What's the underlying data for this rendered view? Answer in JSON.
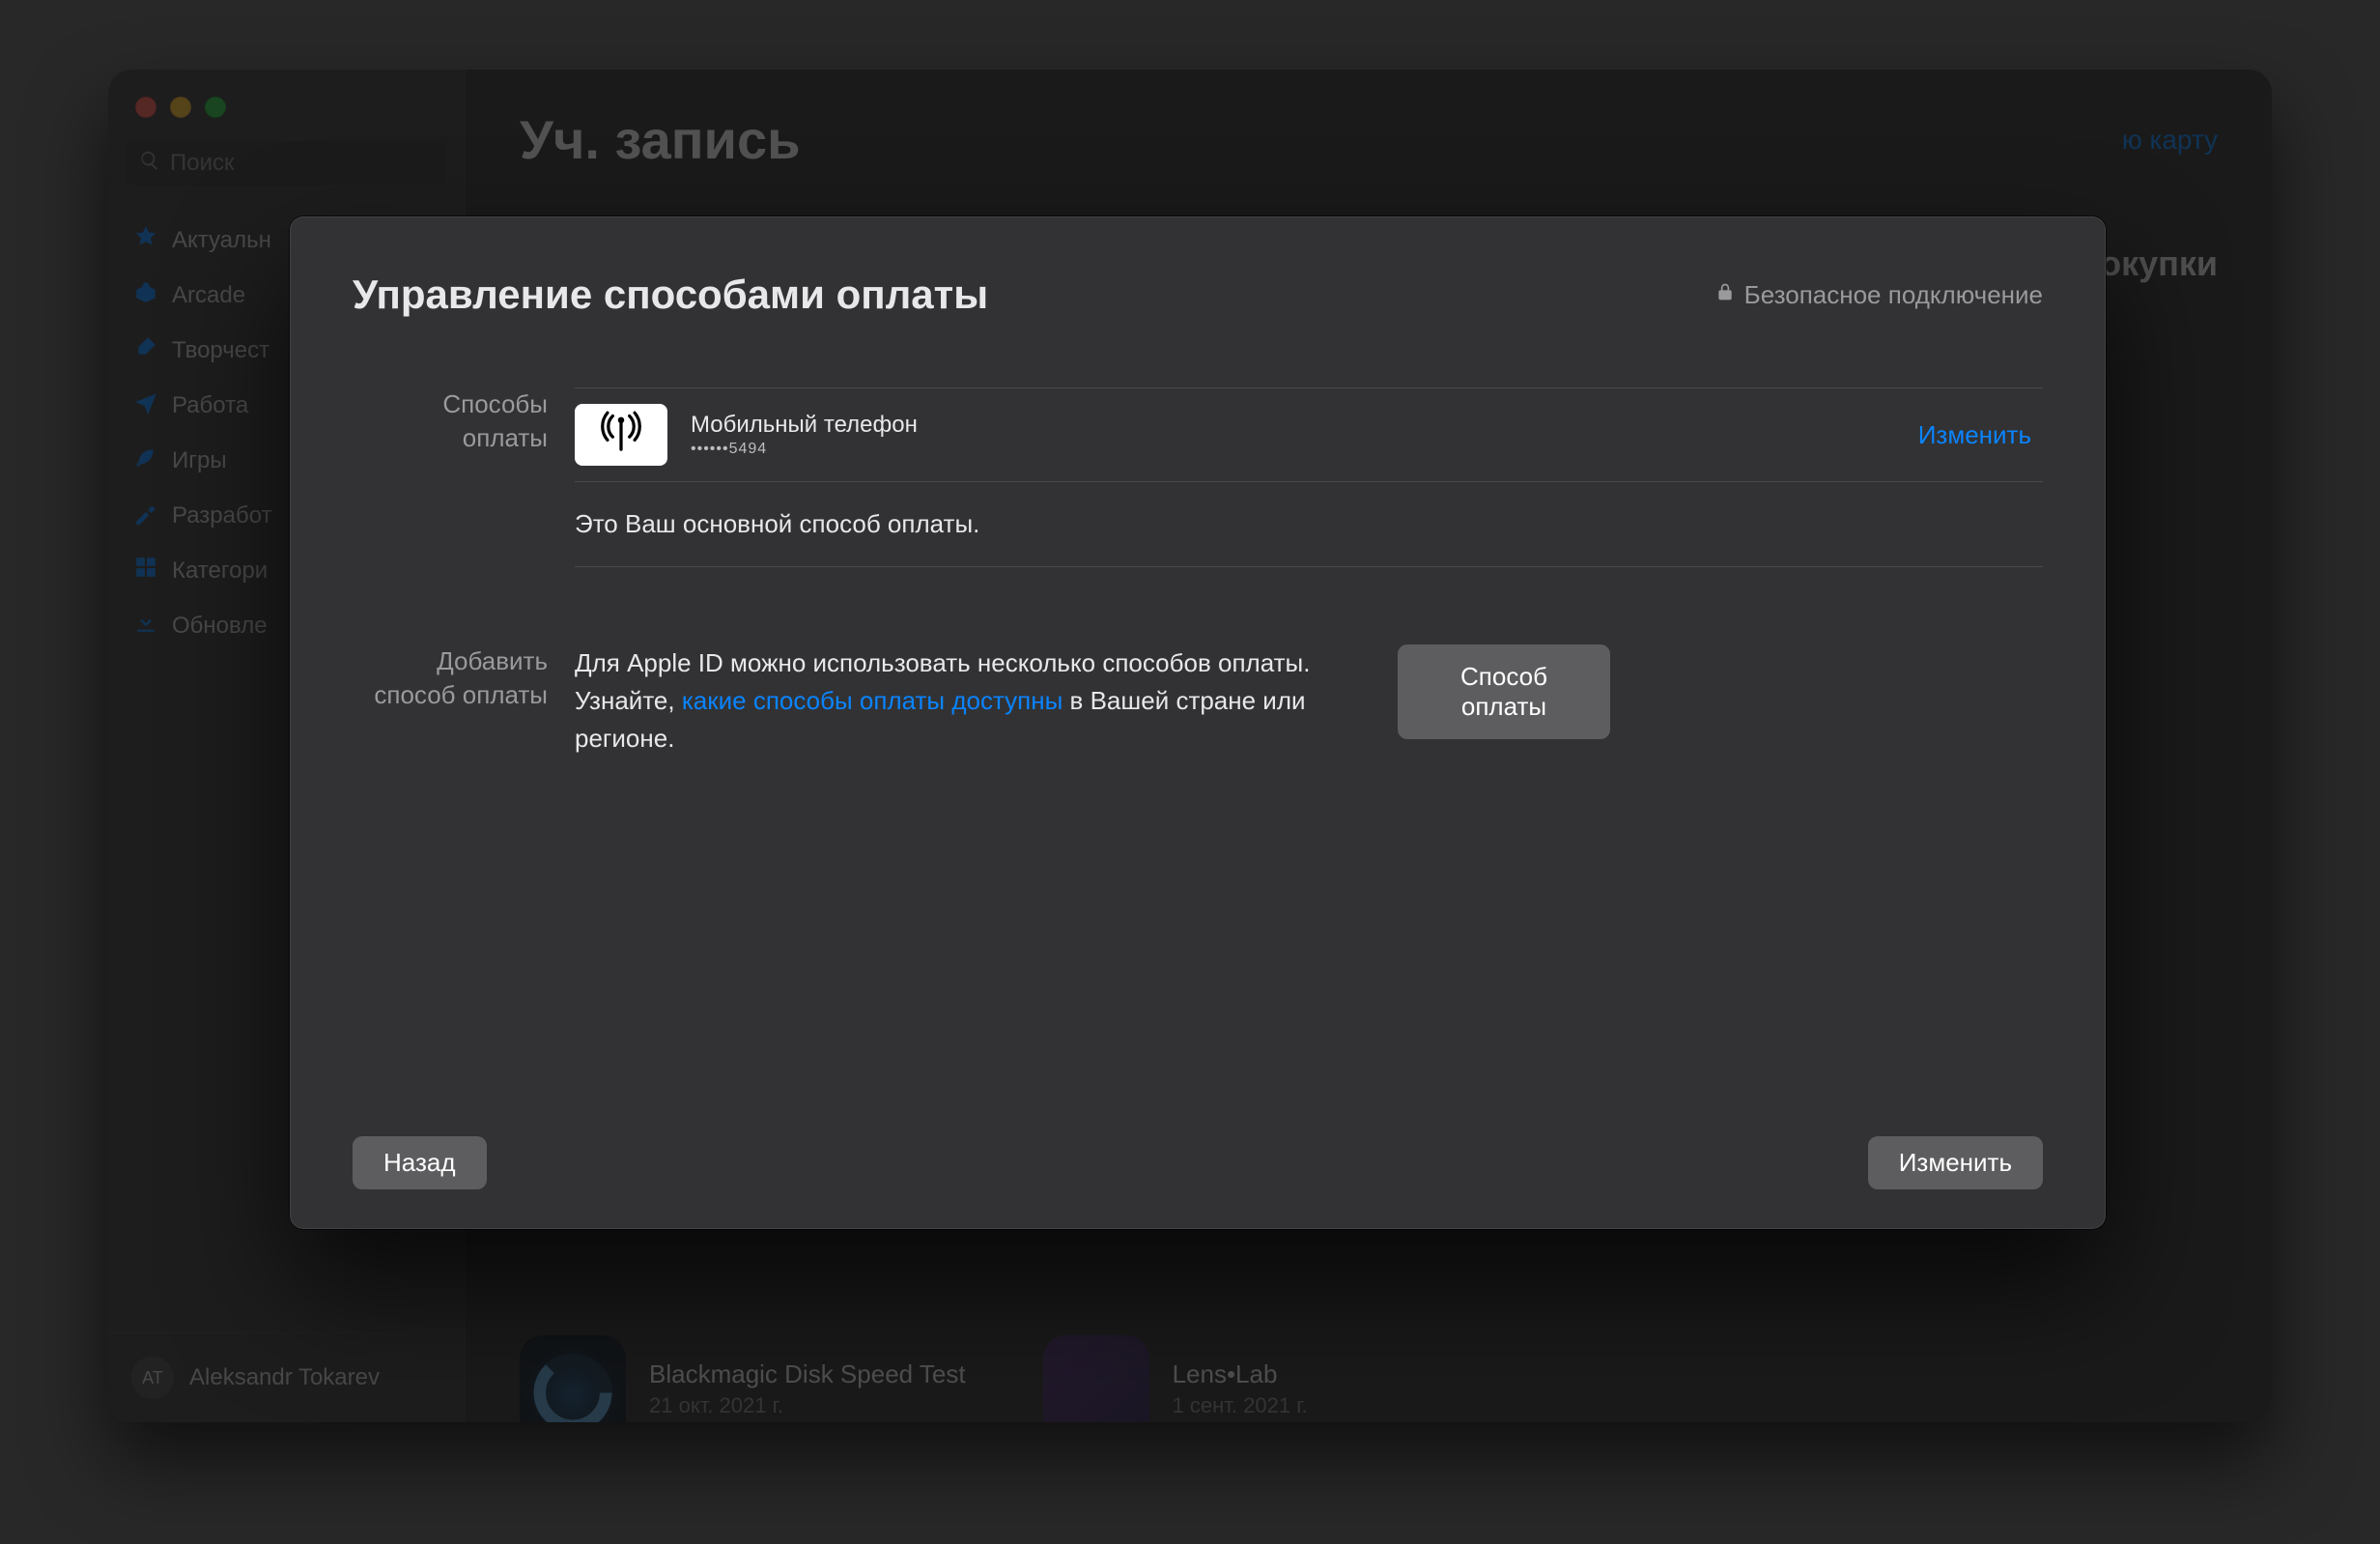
{
  "sidebar": {
    "search_placeholder": "Поиск",
    "items": [
      {
        "label": "Актуальн",
        "icon": "star-icon"
      },
      {
        "label": "Arcade",
        "icon": "arcade-icon"
      },
      {
        "label": "Творчест",
        "icon": "brush-icon"
      },
      {
        "label": "Работа",
        "icon": "plane-icon"
      },
      {
        "label": "Игры",
        "icon": "rocket-icon"
      },
      {
        "label": "Разработ",
        "icon": "hammer-icon"
      },
      {
        "label": "Категори",
        "icon": "grid-icon"
      },
      {
        "label": "Обновле",
        "icon": "download-icon"
      }
    ],
    "account": {
      "initials": "AT",
      "name": "Aleksandr Tokarev"
    }
  },
  "main": {
    "title_partial": "Уч. запись",
    "header_link_right": "ю карту",
    "side_word": "окупки",
    "apps": [
      {
        "name": "Blackmagic Disk Speed Test",
        "date": "21 окт. 2021 г."
      },
      {
        "name": "Lens•Lab",
        "date": "1 сент. 2021 г."
      }
    ]
  },
  "modal": {
    "title": "Управление способами оплаты",
    "secure_label": "Безопасное подключение",
    "section_label": "Способы оплаты",
    "method_name": "Мобильный телефон",
    "method_mask": "••••••5494",
    "edit_link": "Изменить",
    "primary_note": "Это Ваш основной способ оплаты.",
    "add_label": "Добавить способ оплаты",
    "add_text_pre": "Для Apple ID можно использовать несколько способов оплаты. Узнайте, ",
    "add_text_link": "какие способы оплаты доступны",
    "add_text_post": " в Вашей стране или регионе.",
    "add_button": "Способ оплаты",
    "back_button": "Назад",
    "done_button": "Изменить"
  }
}
